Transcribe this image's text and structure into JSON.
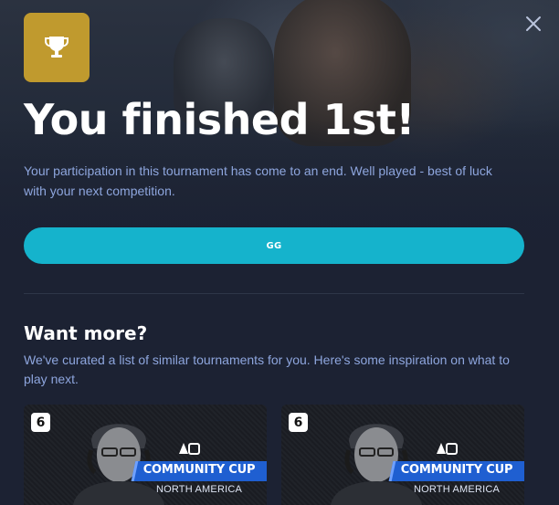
{
  "header": {
    "title": "You finished 1st!",
    "message": "Your participation in this tournament has come to an end. Well played - best of luck with your next competition.",
    "close_icon": "close-icon",
    "trophy_icon": "trophy-icon"
  },
  "actions": {
    "gg_label": "GG"
  },
  "recommendations": {
    "title": "Want more?",
    "description": "We've curated a list of similar tournaments for you. Here's some inspiration on what to play next.",
    "cards": [
      {
        "game_badge": "6",
        "event_name": "COMMUNITY CUP",
        "region": "NORTH AMERICA"
      },
      {
        "game_badge": "6",
        "event_name": "COMMUNITY CUP",
        "region": "NORTH AMERICA"
      }
    ]
  },
  "colors": {
    "background": "#1c2233",
    "accent": "#15b3cc",
    "trophy_badge": "#c09a2e",
    "text_secondary": "#8ea6de",
    "banner_blue": "#1f5fd1"
  }
}
